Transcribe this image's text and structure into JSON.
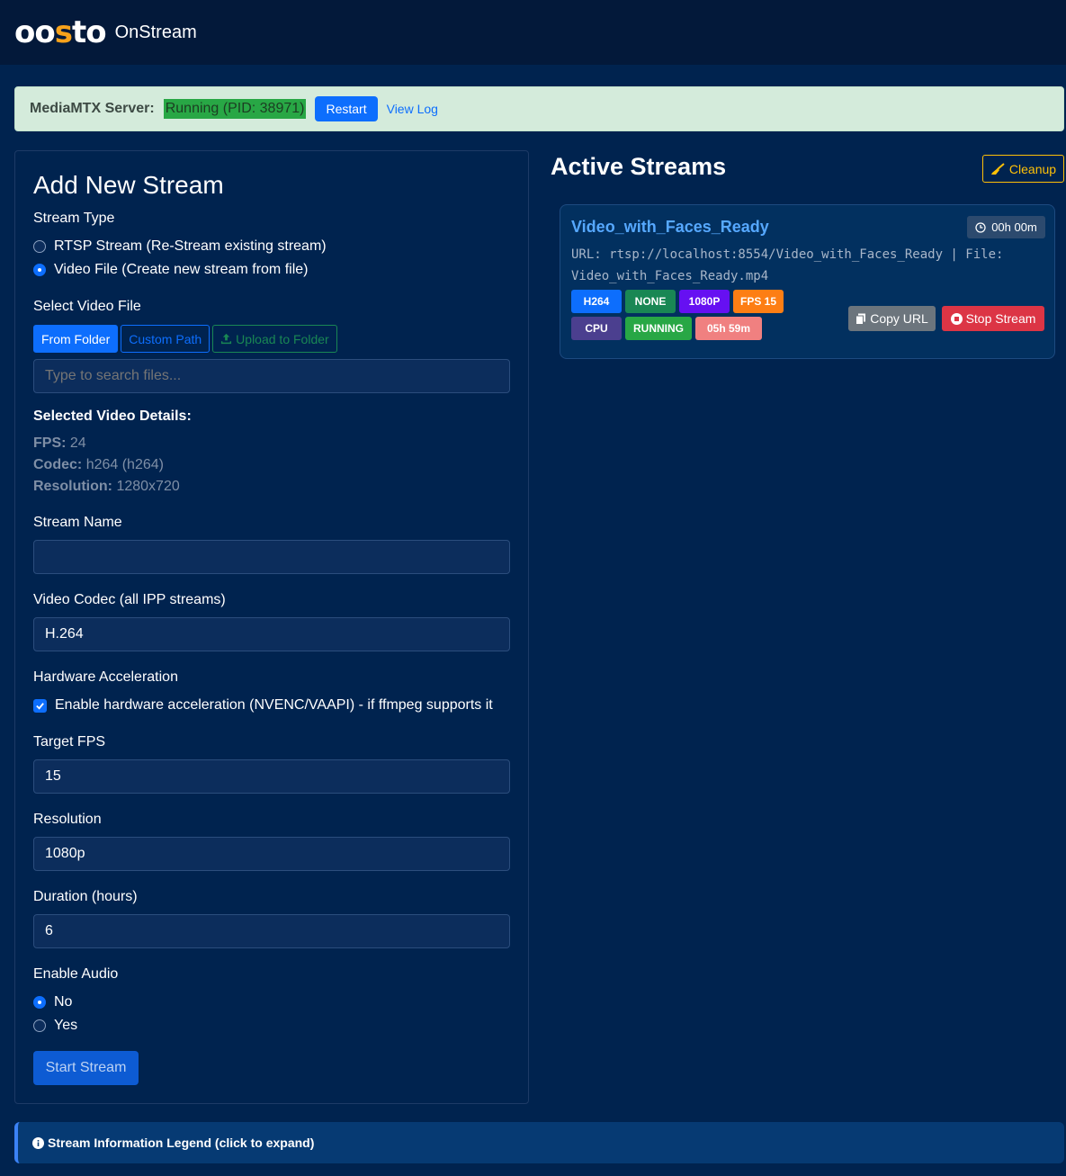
{
  "brand": {
    "logo_part1": "oo",
    "logo_part2": "s",
    "logo_part3": "to",
    "app_name": "OnStream"
  },
  "server": {
    "label": "MediaMTX Server:",
    "status": "Running (PID: 38971)",
    "restart_label": "Restart",
    "view_log_label": "View Log"
  },
  "add_stream": {
    "title": "Add New Stream",
    "stream_type_label": "Stream Type",
    "stream_type_options": [
      {
        "label": "RTSP Stream (Re-Stream existing stream)",
        "checked": false
      },
      {
        "label": "Video File (Create new stream from file)",
        "checked": true
      }
    ],
    "select_file_label": "Select Video File",
    "source_tabs": [
      "From Folder",
      "Custom Path",
      "Upload to Folder"
    ],
    "search_placeholder": "Type to search files...",
    "details_title": "Selected Video Details:",
    "details": {
      "fps_key": "FPS:",
      "fps_value": "24",
      "codec_key": "Codec:",
      "codec_value": "h264 (h264)",
      "resolution_key": "Resolution:",
      "resolution_value": "1280x720"
    },
    "stream_name_label": "Stream Name",
    "stream_name_value": "",
    "codec_label": "Video Codec (all IPP streams)",
    "codec_value": "H.264",
    "hw_label": "Hardware Acceleration",
    "hw_checkbox_label": "Enable hardware acceleration (NVENC/VAAPI) - if ffmpeg supports it",
    "hw_checked": true,
    "fps_label": "Target FPS",
    "fps_value": "15",
    "resolution_label": "Resolution",
    "resolution_value": "1080p",
    "duration_label": "Duration (hours)",
    "duration_value": "6",
    "audio_label": "Enable Audio",
    "audio_options": [
      {
        "label": "No",
        "checked": true
      },
      {
        "label": "Yes",
        "checked": false
      }
    ],
    "start_label": "Start Stream"
  },
  "active": {
    "title": "Active Streams",
    "cleanup_label": "Cleanup",
    "streams": [
      {
        "name": "Video_with_Faces_Ready",
        "uptime": "00h 00m",
        "url_line1": "URL: rtsp://localhost:8554/Video_with_Faces_Ready | File:",
        "url_line2": "Video_with_Faces_Ready.mp4",
        "badges": [
          {
            "text": "H264",
            "color": "#0d6efd"
          },
          {
            "text": "NONE",
            "color": "#198754"
          },
          {
            "text": "1080P",
            "color": "#6610f2"
          },
          {
            "text": "FPS 15",
            "color": "#fd7e14"
          },
          {
            "text": "CPU",
            "color": "#4b3f8f"
          },
          {
            "text": "RUNNING",
            "color": "#28a745"
          },
          {
            "text": "05h 59m",
            "color": "#f08080"
          }
        ],
        "copy_label": "Copy URL",
        "stop_label": "Stop Stream"
      }
    ]
  },
  "legend": {
    "label": "Stream Information Legend (click to expand)"
  }
}
